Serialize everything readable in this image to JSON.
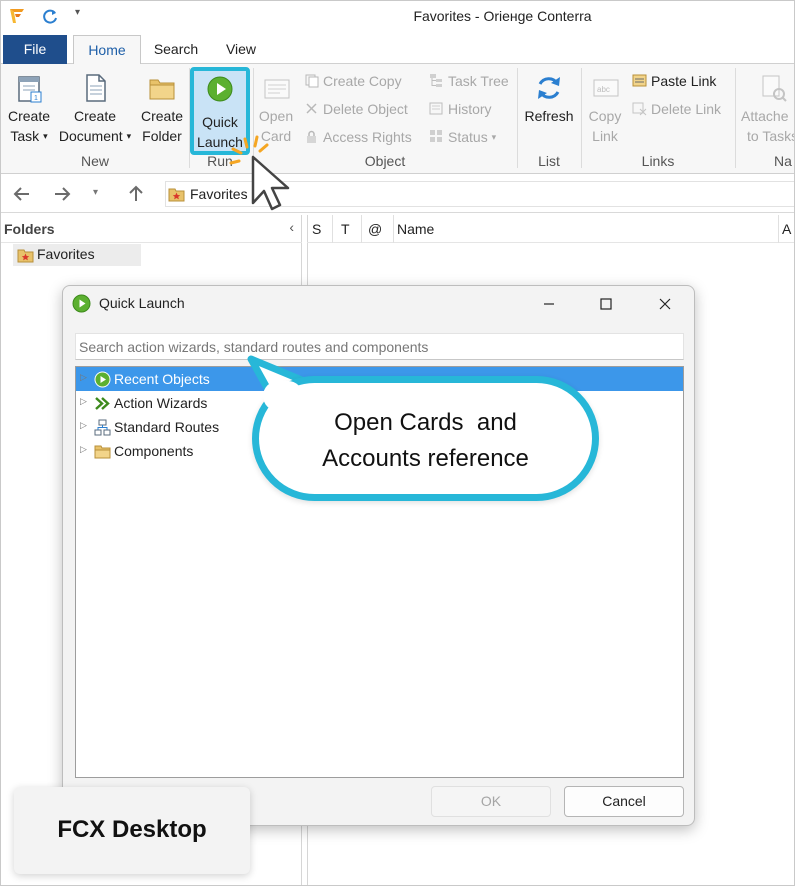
{
  "window": {
    "title": "Favorites - Oriенge Conterra"
  },
  "quick_access": {
    "logo_icon": "oriente-logo-icon",
    "refresh_icon": "refresh-icon",
    "dropdown_glyph": "▾"
  },
  "ribbon_tabs": [
    {
      "label": "File"
    },
    {
      "label": "Home"
    },
    {
      "label": "Search"
    },
    {
      "label": "View"
    }
  ],
  "ribbon": {
    "new_group": {
      "label": "New",
      "create_task": {
        "line1": "Create",
        "line2": "Task"
      },
      "create_document": {
        "line1": "Create",
        "line2": "Document"
      },
      "create_folder": {
        "line1": "Create",
        "line2": "Folder"
      }
    },
    "run_group": {
      "label": "Run",
      "quick_launch": {
        "line1": "Quick",
        "line2": "Launch"
      }
    },
    "object_group": {
      "label": "Object",
      "open_card": {
        "line1": "Open",
        "line2": "Card"
      },
      "create_copy": "Create Copy",
      "delete_object": "Delete Object",
      "access_rights": "Access Rights",
      "task_tree": "Task Tree",
      "history": "History",
      "status": "Status"
    },
    "list_group": {
      "label": "List",
      "refresh": "Refresh"
    },
    "links_group": {
      "label": "Links",
      "copy_link": {
        "line1": "Copy",
        "line2": "Link"
      },
      "paste_link": "Paste Link",
      "delete_link": "Delete Link"
    },
    "na_group": {
      "label": "Na",
      "attached": {
        "line1": "Attache",
        "line2": "to Tasks"
      }
    }
  },
  "address_bar": {
    "path": "Favorites"
  },
  "folders_panel": {
    "title": "Folders",
    "collapse_glyph": "‹",
    "items": [
      {
        "label": "Favorites"
      }
    ]
  },
  "list_columns": [
    {
      "label": "S"
    },
    {
      "label": "T"
    },
    {
      "label": "@"
    },
    {
      "label": "Name"
    },
    {
      "label": "A"
    }
  ],
  "dialog": {
    "title": "Quick Launch",
    "search_placeholder": "Search action wizards, standard routes and components",
    "tree": [
      {
        "label": "Recent Objects",
        "icon": "play-icon",
        "selected": true
      },
      {
        "label": "Action Wizards",
        "icon": "double-chevron-icon",
        "selected": false
      },
      {
        "label": "Standard Routes",
        "icon": "route-icon",
        "selected": false
      },
      {
        "label": "Components",
        "icon": "folder-icon",
        "selected": false
      }
    ],
    "ok_label": "OK",
    "cancel_label": "Cancel"
  },
  "callout": {
    "line1": "Open Cards  and",
    "line2": "Accounts reference"
  },
  "badge": {
    "label": "FCX Desktop"
  },
  "colors": {
    "accent": "#27b7d8",
    "file_tab": "#1f4e8c",
    "selection": "#3c97ea",
    "play_green": "#5cb030"
  }
}
